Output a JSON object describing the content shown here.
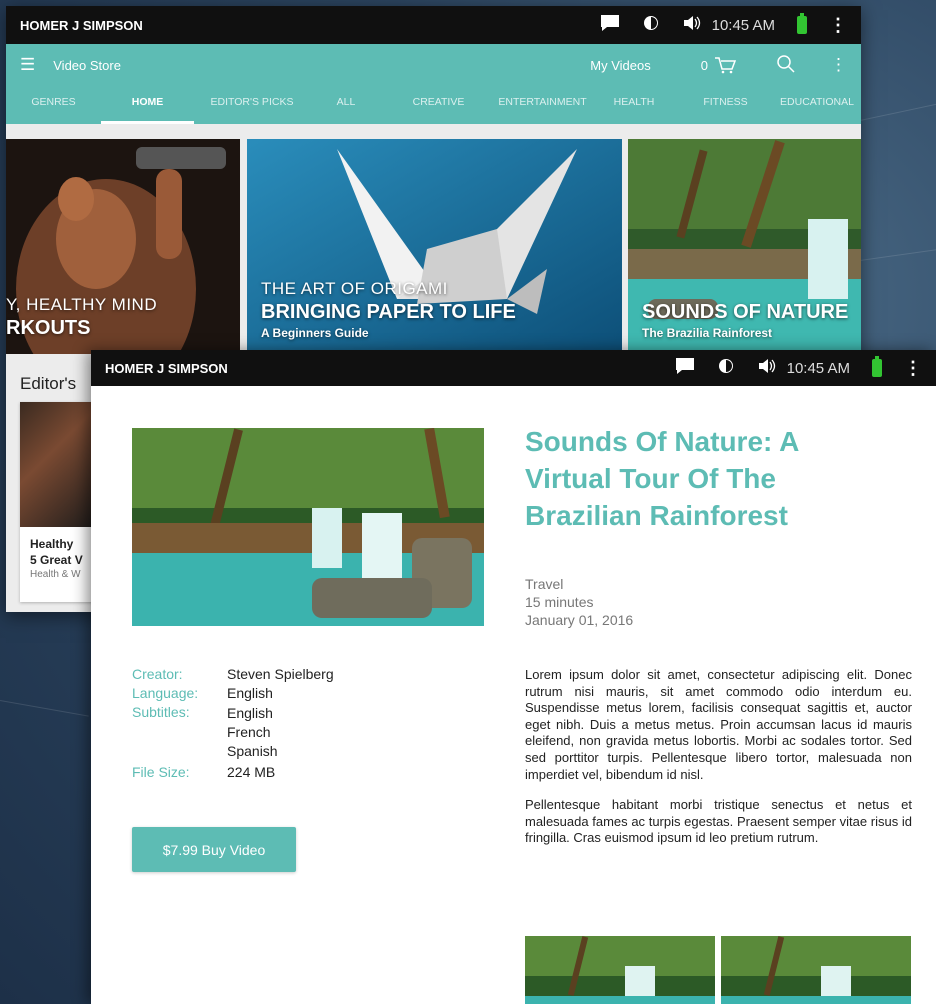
{
  "back_window": {
    "status": {
      "user": "HOMER J SIMPSON",
      "time": "10:45 AM"
    },
    "appbar": {
      "title": "Video Store",
      "my_videos": "My Videos",
      "cart_count": "0"
    },
    "tabs": [
      "GENRES",
      "HOME",
      "EDITOR'S PICKS",
      "ALL",
      "CREATIVE",
      "ENTERTAINMENT",
      "HEALTH",
      "FITNESS",
      "EDUCATIONAL"
    ],
    "active_tab": "HOME",
    "heroes": [
      {
        "line1": "Y, HEALTHY MIND",
        "line2": "RKOUTS",
        "line3": ""
      },
      {
        "line1": "THE ART OF ORIGAMI",
        "line2": "BRINGING PAPER TO LIFE",
        "line3": "A Beginners Guide"
      },
      {
        "line1": "",
        "line2": "SOUNDS OF NATURE",
        "line3": "The Brazilia Rainforest"
      }
    ],
    "editors_heading": "Editor's",
    "card": {
      "title1": "Healthy",
      "title2": "5 Great V",
      "sub": "Health & W"
    }
  },
  "front_window": {
    "status": {
      "user": "HOMER J SIMPSON",
      "time": "10:45 AM"
    },
    "title": "Sounds Of Nature: A Virtual Tour Of The Brazilian Rainforest",
    "meta": {
      "category": "Travel",
      "duration": "15 minutes",
      "date": "January 01, 2016"
    },
    "details": {
      "creator_label": "Creator:",
      "creator": "Steven Spielberg",
      "language_label": "Language:",
      "language": "English",
      "subtitles_label": "Subtitles:",
      "subtitles": [
        "English",
        "French",
        "Spanish"
      ],
      "filesize_label": "File Size:",
      "filesize": "224 MB"
    },
    "buy_button": "$7.99 Buy Video",
    "description": [
      "Lorem ipsum dolor sit amet, consectetur adipiscing elit. Donec rutrum nisi mauris, sit amet commodo odio interdum eu. Suspendisse metus lorem, facilisis consequat sagittis et, auctor eget nibh. Duis a metus metus. Proin accumsan lacus id mauris eleifend, non gravida metus lobortis. Morbi ac sodales tortor. Sed sed porttitor turpis. Pellentesque libero tortor, malesuada non imperdiet vel, bibendum id nisl.",
      "Pellentesque habitant morbi tristique senectus et netus et malesuada fames ac turpis egestas. Praesent semper vitae risus id fringilla. Cras euismod ipsum id leo pretium rutrum."
    ]
  },
  "colors": {
    "accent": "#5dbcb4",
    "statusbar": "#101010",
    "battery": "#32c532"
  }
}
